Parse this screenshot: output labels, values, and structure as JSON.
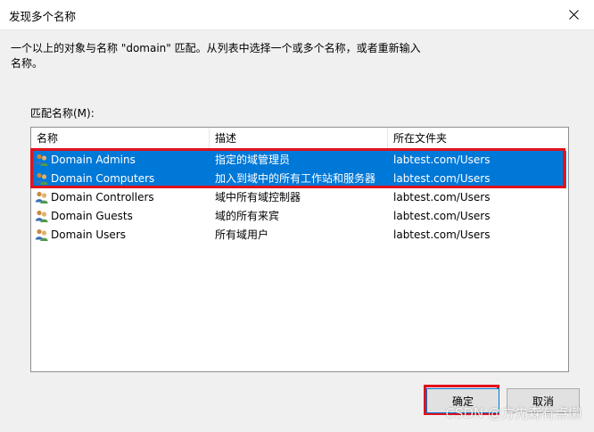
{
  "window": {
    "title": "发现多个名称",
    "message": "一个以上的对象与名称 \"domain\" 匹配。从列表中选择一个或多个名称，或者重新输入名称。"
  },
  "list": {
    "label": "匹配名称(M):",
    "columns": [
      "名称",
      "描述",
      "所在文件夹"
    ],
    "rows": [
      {
        "name": "Domain Admins",
        "description": "指定的域管理员",
        "folder": "labtest.com/Users",
        "selected": true
      },
      {
        "name": "Domain Computers",
        "description": "加入到域中的所有工作站和服务器",
        "folder": "labtest.com/Users",
        "selected": true
      },
      {
        "name": "Domain Controllers",
        "description": "域中所有域控制器",
        "folder": "labtest.com/Users",
        "selected": false
      },
      {
        "name": "Domain Guests",
        "description": "域的所有来宾",
        "folder": "labtest.com/Users",
        "selected": false
      },
      {
        "name": "Domain Users",
        "description": "所有域用户",
        "folder": "labtest.com/Users",
        "selected": false
      }
    ],
    "row_icon": "user-group-icon"
  },
  "buttons": {
    "ok": "确定",
    "cancel": "取消"
  },
  "watermark": "CSDN @方先森有点懒",
  "colors": {
    "selection": "#0078d7",
    "highlight_box": "#e0131d"
  }
}
